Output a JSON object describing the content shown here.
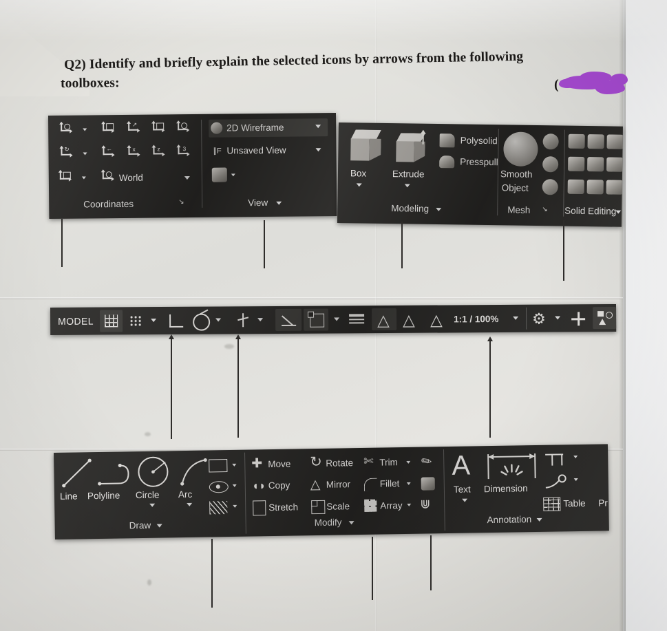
{
  "question": {
    "line1": "Q2) Identify and briefly explain the selected icons by arrows from the following",
    "line2": "toolboxes:",
    "paren": "(",
    "redaction_color": "#a64ad1",
    "redaction_name": "purple-marker-redaction"
  },
  "ribbon_top": {
    "coordinates_panel": {
      "name": "Coordinates",
      "dialog_launcher": "↘",
      "ucs_buttons": [
        {
          "name": "ucs-world-origin"
        },
        {
          "name": "ucs-named"
        },
        {
          "name": "ucs-3point"
        },
        {
          "name": "ucs-object"
        },
        {
          "name": "ucs-face"
        },
        {
          "name": "ucs-rotate"
        },
        {
          "name": "ucs-previous"
        },
        {
          "name": "ucs-x"
        },
        {
          "name": "ucs-y"
        },
        {
          "name": "ucs-z"
        },
        {
          "name": "ucs-icon-properties"
        }
      ],
      "world_label": "World"
    },
    "view_panel": {
      "name": "View",
      "visual_style": "2D Wireframe",
      "named_view": "Unsaved View",
      "viewport_tools_icon": "viewport-configuration-icon"
    },
    "modeling_panel": {
      "name": "Modeling",
      "box_label": "Box",
      "extrude_label": "Extrude",
      "polysolid_label": "Polysolid",
      "presspull_label": "Presspull"
    },
    "mesh_panel": {
      "name": "Mesh",
      "smooth_object_label_1": "Smooth",
      "smooth_object_label_2": "Object",
      "dialog_launcher": "↘"
    },
    "solid_editing_panel": {
      "name": "Solid Editing"
    }
  },
  "status_bar": {
    "model_label": "MODEL",
    "scale_label": "1:1 / 100%",
    "icons": [
      {
        "name": "grid-display-icon"
      },
      {
        "name": "snap-mode-icon"
      },
      {
        "name": "ortho-mode-icon"
      },
      {
        "name": "polar-tracking-icon"
      },
      {
        "name": "object-snap-tracking-icon"
      },
      {
        "name": "object-snap-icon"
      },
      {
        "name": "lineweight-icon"
      },
      {
        "name": "annotation-visibility-icon"
      },
      {
        "name": "autoscale-icon"
      },
      {
        "name": "annotation-scale-icon"
      },
      {
        "name": "workspace-switching-icon"
      },
      {
        "name": "hardware-acceleration-icon"
      },
      {
        "name": "isolate-objects-icon"
      },
      {
        "name": "clean-screen-icon"
      },
      {
        "name": "customization-icon"
      }
    ]
  },
  "ribbon_bottom": {
    "draw_panel": {
      "name": "Draw",
      "items": [
        "Line",
        "Polyline",
        "Circle",
        "Arc"
      ],
      "flyouts": [
        {
          "name": "rectangle-flyout"
        },
        {
          "name": "ellipse-flyout"
        },
        {
          "name": "hatch-flyout"
        }
      ]
    },
    "modify_panel": {
      "name": "Modify",
      "col1": [
        "Move",
        "Copy",
        "Stretch"
      ],
      "col2": [
        "Rotate",
        "Mirror",
        "Scale"
      ],
      "col3": [
        "Trim",
        "Fillet",
        "Array"
      ],
      "extra_icons": [
        {
          "name": "erase-icon"
        },
        {
          "name": "explode-icon"
        },
        {
          "name": "offset-icon"
        }
      ]
    },
    "annotation_panel": {
      "name": "Annotation",
      "text_label": "Text",
      "dimension_label": "Dimension",
      "leader_icon": "leader-icon",
      "table_label": "Table",
      "truncated_label": "Pr"
    }
  },
  "leader_lines": [
    {
      "name": "leader-to-ucs-icon",
      "direction": "down"
    },
    {
      "name": "leader-to-view-panel",
      "direction": "down"
    },
    {
      "name": "leader-to-extrude",
      "direction": "down"
    },
    {
      "name": "leader-to-solid-editing",
      "direction": "down"
    },
    {
      "name": "leader-to-ortho-mode",
      "direction": "up"
    },
    {
      "name": "leader-to-object-snap-tracking",
      "direction": "up"
    },
    {
      "name": "leader-to-customization",
      "direction": "up"
    },
    {
      "name": "leader-to-draw-flyout",
      "direction": "down"
    },
    {
      "name": "leader-to-fillet",
      "direction": "down"
    },
    {
      "name": "leader-to-offset",
      "direction": "down"
    }
  ]
}
